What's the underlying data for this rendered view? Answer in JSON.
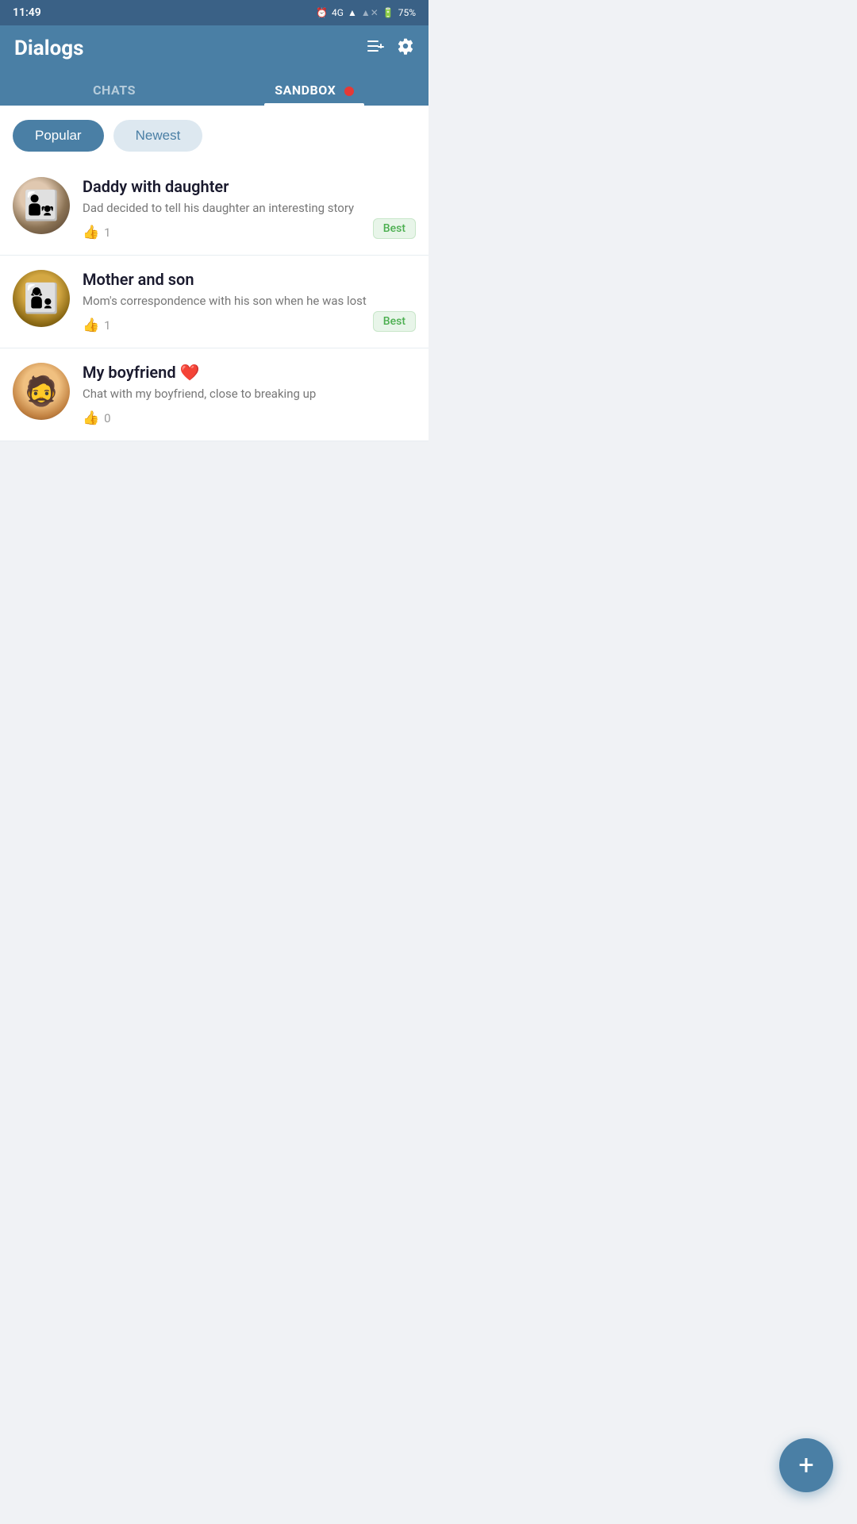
{
  "statusBar": {
    "time": "11:49",
    "signal": "4G",
    "battery": "75%"
  },
  "header": {
    "title": "Dialogs",
    "addMenuLabel": "add menu",
    "settingsLabel": "settings"
  },
  "tabs": [
    {
      "id": "chats",
      "label": "CHATS",
      "active": false,
      "hasBadge": false
    },
    {
      "id": "sandbox",
      "label": "SANDBOX",
      "active": true,
      "hasBadge": true
    }
  ],
  "filters": [
    {
      "id": "popular",
      "label": "Popular",
      "active": true
    },
    {
      "id": "newest",
      "label": "Newest",
      "active": false
    }
  ],
  "chats": [
    {
      "id": "daddy",
      "title": "Daddy with daughter",
      "description": "Dad decided to tell his daughter an interesting story",
      "likes": 1,
      "badge": "Best",
      "avatarType": "daddy"
    },
    {
      "id": "mother",
      "title": "Mother and son",
      "description": "Mom's correspondence with his son when he was lost",
      "likes": 1,
      "badge": "Best",
      "avatarType": "mother"
    },
    {
      "id": "boyfriend",
      "title": "My boyfriend",
      "titleEmoji": "❤️",
      "description": "Chat with my boyfriend, close to breaking up",
      "likes": 0,
      "badge": null,
      "avatarType": "boyfriend"
    }
  ],
  "fab": {
    "label": "+"
  }
}
